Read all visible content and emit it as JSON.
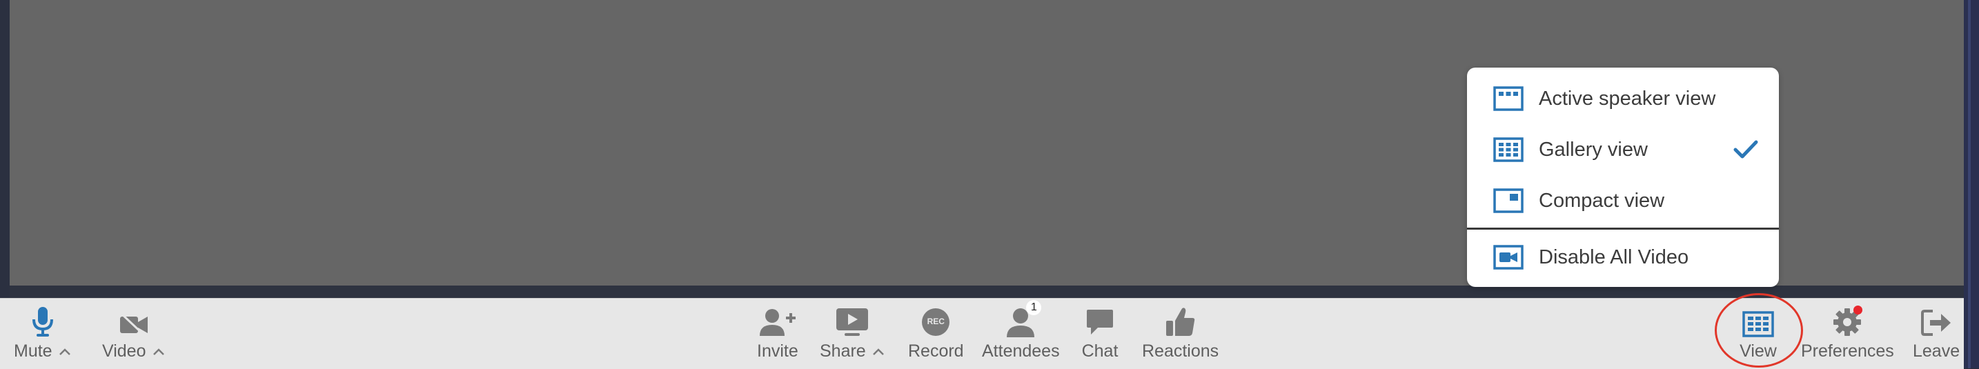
{
  "view_menu": {
    "items": [
      {
        "label": "Active speaker view",
        "icon": "active-speaker-icon",
        "checked": false
      },
      {
        "label": "Gallery view",
        "icon": "gallery-grid-icon",
        "checked": true
      },
      {
        "label": "Compact view",
        "icon": "compact-view-icon",
        "checked": false
      },
      {
        "label": "Disable All Video",
        "icon": "video-camera-icon",
        "checked": false
      }
    ]
  },
  "toolbar": {
    "mute_label": "Mute",
    "video_label": "Video",
    "invite_label": "Invite",
    "share_label": "Share",
    "record_label": "Record",
    "record_icon_text": "REC",
    "attendees_label": "Attendees",
    "attendees_count": "1",
    "chat_label": "Chat",
    "reactions_label": "Reactions",
    "view_label": "View",
    "preferences_label": "Preferences",
    "leave_label": "Leave"
  },
  "colors": {
    "accent_blue": "#2a77b6",
    "icon_gray": "#7a7a7a",
    "highlight_ring": "#e1372a",
    "notification_dot": "#e8262c"
  }
}
